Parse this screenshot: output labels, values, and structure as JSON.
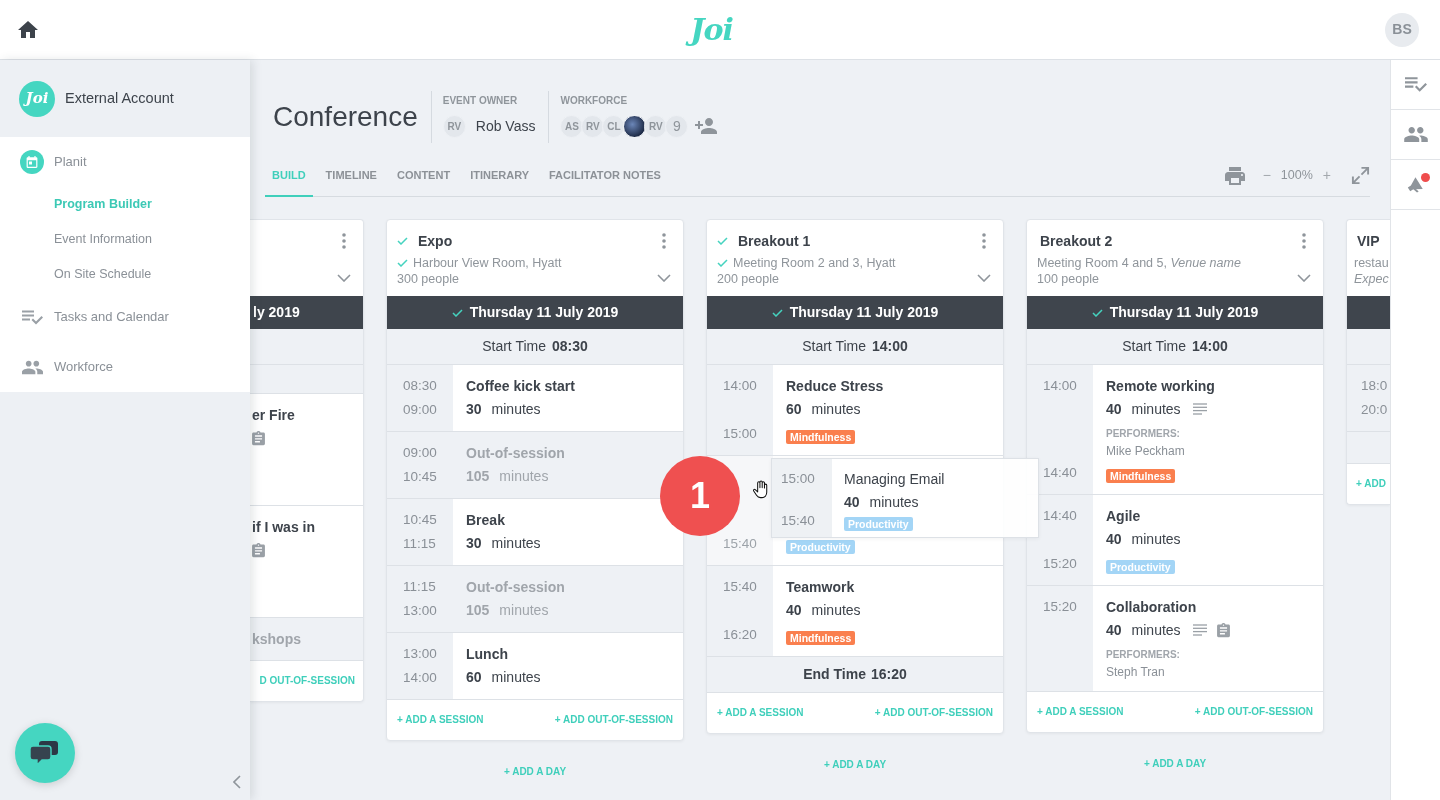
{
  "topbar": {
    "logo": "Joi",
    "avatar": "BS"
  },
  "sidebar": {
    "account": {
      "logo": "Joi",
      "name": "External Account"
    },
    "items": [
      {
        "label": "Planit",
        "selected": false,
        "expanded": true,
        "children": [
          {
            "label": "Program Builder",
            "selected": true
          },
          {
            "label": "Event Information",
            "selected": false
          },
          {
            "label": "On Site Schedule",
            "selected": false
          }
        ]
      },
      {
        "label": "Tasks and Calendar",
        "selected": false,
        "expanded": false
      },
      {
        "label": "Workforce",
        "selected": false,
        "expanded": false
      }
    ]
  },
  "event": {
    "title": "Conference",
    "owner": {
      "label": "EVENT OWNER",
      "initials": "RV",
      "name": "Rob Vass"
    },
    "workforce": {
      "label": "WORKFORCE",
      "members": [
        {
          "kind": "initials",
          "initials": "AS"
        },
        {
          "kind": "initials",
          "initials": "RV"
        },
        {
          "kind": "initials",
          "initials": "CL"
        },
        {
          "kind": "photo"
        },
        {
          "kind": "initials",
          "initials": "RV"
        }
      ],
      "more": "9"
    }
  },
  "tabs": [
    {
      "label": "BUILD",
      "selected": true
    },
    {
      "label": "TIMELINE",
      "selected": false
    },
    {
      "label": "CONTENT",
      "selected": false
    },
    {
      "label": "ITINERARY",
      "selected": false
    },
    {
      "label": "FACILITATOR NOTES",
      "selected": false
    }
  ],
  "toolbar": {
    "zoom_out": "−",
    "zoom": "100%",
    "zoom_in": "+"
  },
  "columns": [
    {
      "day": {
        "label": "ly 2019"
      },
      "sessions": [
        {
          "kind": "out_of_session"
        },
        {
          "kind": "session",
          "title": "er Fire",
          "notes": false,
          "clipboard": true
        },
        {
          "kind": "session",
          "title": "if I was in",
          "notes": false,
          "clipboard": true
        },
        {
          "kind": "out_of_session",
          "title": "kshops"
        }
      ],
      "footer": {
        "add_out_of_session": "D OUT-OF-SESSION"
      }
    },
    {
      "title": "Expo",
      "title_checked": true,
      "venue": "Harbour View Room, Hyatt",
      "venue_checked": true,
      "people": "300 people",
      "people_hint": false,
      "day": {
        "label": "Thursday 11 July 2019",
        "checked": true
      },
      "start": {
        "label": "Start Time",
        "time": "08:30"
      },
      "sessions": [
        {
          "kind": "session",
          "start": "08:30",
          "end": "09:00",
          "title": "Coffee kick start",
          "minutes": "30",
          "unit": "minutes",
          "notes": false,
          "clipboard": false
        },
        {
          "kind": "out_of_session",
          "start": "09:00",
          "end": "10:45",
          "title": "Out-of-session",
          "minutes": "105",
          "unit": "minutes"
        },
        {
          "kind": "session",
          "start": "10:45",
          "end": "11:15",
          "title": "Break",
          "minutes": "30",
          "unit": "minutes",
          "notes": false,
          "clipboard": false
        },
        {
          "kind": "out_of_session",
          "start": "11:15",
          "end": "13:00",
          "title": "Out-of-session",
          "minutes": "105",
          "unit": "minutes"
        },
        {
          "kind": "session",
          "start": "13:00",
          "end": "14:00",
          "title": "Lunch",
          "minutes": "60",
          "unit": "minutes",
          "notes": false,
          "clipboard": false
        }
      ],
      "footer": {
        "add_session": "+ ADD A SESSION",
        "add_out_of_session": "+ ADD OUT-OF-SESSION"
      },
      "add_day": "+ ADD A DAY"
    },
    {
      "title": "Breakout 1",
      "title_checked": true,
      "venue": "Meeting Room 2 and 3, Hyatt",
      "venue_checked": true,
      "people": "200 people",
      "people_hint": false,
      "day": {
        "label": "Thursday 11 July 2019",
        "checked": true
      },
      "start": {
        "label": "Start Time",
        "time": "14:00"
      },
      "sessions": [
        {
          "kind": "session",
          "start": "14:00",
          "end": "15:00",
          "title": "Reduce Stress",
          "minutes": "60",
          "unit": "minutes",
          "notes": false,
          "clipboard": false,
          "tags": [
            {
              "label": "Mindfulness",
              "color": "#fa7f4e"
            }
          ]
        },
        {
          "kind": "placeholder",
          "end": "15:40",
          "tags": [
            {
              "label": "Productivity",
              "color": "#a3d5f6"
            }
          ],
          "dragged": {
            "start": "15:00",
            "end": "15:40",
            "title": "Managing Email",
            "minutes": "40",
            "unit": "minutes",
            "tags": [
              {
                "label": "Productivity",
                "color": "#a3d5f6"
              }
            ]
          },
          "step_marker": "1"
        },
        {
          "kind": "session",
          "start": "15:40",
          "end": "16:20",
          "title": "Teamwork",
          "minutes": "40",
          "unit": "minutes",
          "notes": false,
          "clipboard": false,
          "tags": [
            {
              "label": "Mindfulness",
              "color": "#fa7f4e"
            }
          ]
        }
      ],
      "end": {
        "label": "End Time",
        "time": "16:20"
      },
      "footer": {
        "add_session": "+ ADD A SESSION",
        "add_out_of_session": "+ ADD OUT-OF-SESSION"
      },
      "add_day": "+ ADD A DAY"
    },
    {
      "title": "Breakout 2",
      "title_checked": false,
      "venue": "Meeting Room 4 and 5, *Venue name*",
      "venue_checked": false,
      "people": "100 people",
      "people_hint": false,
      "day": {
        "label": "Thursday 11 July 2019",
        "checked": true
      },
      "start": {
        "label": "Start Time",
        "time": "14:00"
      },
      "sessions": [
        {
          "kind": "session",
          "start": "14:00",
          "end": "14:40",
          "title": "Remote working",
          "minutes": "40",
          "unit": "minutes",
          "notes": true,
          "clipboard": false,
          "performers_label": "PERFORMERS:",
          "performers": "Mike Peckham",
          "tags": [
            {
              "label": "Mindfulness",
              "color": "#fa7f4e"
            }
          ]
        },
        {
          "kind": "session",
          "start": "14:40",
          "end": "15:20",
          "title": "Agile",
          "minutes": "40",
          "unit": "minutes",
          "notes": false,
          "clipboard": false,
          "tags": [
            {
              "label": "Productivity",
              "color": "#a3d5f6"
            }
          ]
        },
        {
          "kind": "session",
          "start": "15:20",
          "title": "Collaboration",
          "minutes": "40",
          "unit": "minutes",
          "notes": true,
          "clipboard": true,
          "performers_label": "PERFORMERS:",
          "performers": "Steph Tran"
        }
      ],
      "footer": {
        "add_session": "+ ADD A SESSION",
        "add_out_of_session": "+ ADD OUT-OF-SESSION"
      },
      "add_day": "+ ADD A DAY"
    },
    {
      "title": "VIP",
      "title_checked": false,
      "venue": "restau",
      "venue_checked": false,
      "people": "Expec",
      "people_hint": true,
      "sessions": [
        {
          "kind": "session",
          "start": "18:0",
          "end": "20:0",
          "notes": false,
          "clipboard": false
        },
        {
          "kind": "out_of_session"
        }
      ],
      "footer": {
        "add_session": "+ ADD"
      }
    }
  ],
  "right_rail": {
    "notification": true
  }
}
